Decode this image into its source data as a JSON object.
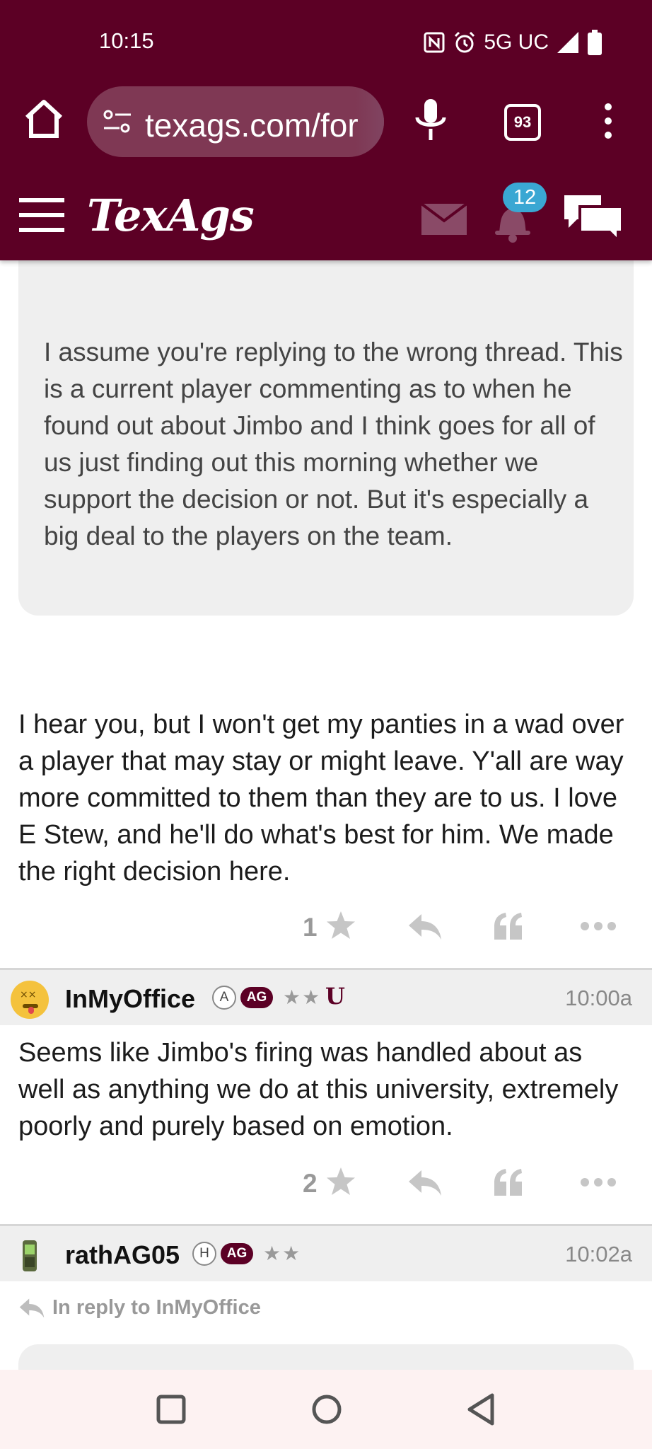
{
  "status_bar": {
    "time": "10:15",
    "network": "5G UC",
    "icons": [
      "nfc-icon",
      "alarm-icon",
      "signal-icon",
      "battery-icon"
    ]
  },
  "browser": {
    "url": "texags.com/for",
    "tab_count": "93",
    "icons": [
      "home-icon",
      "site-settings-icon",
      "mic-icon",
      "tabs-icon",
      "more-vert-icon"
    ]
  },
  "site_header": {
    "logo": "TexAgs",
    "notification_count": "12",
    "icons": [
      "hamburger-icon",
      "mail-icon",
      "bell-icon",
      "chat-icon"
    ]
  },
  "posts": [
    {
      "quote": "I assume you're replying to the wrong thread. This is a current player commenting as to when he found out about Jimbo and I think goes for all of us just finding out this morning whether we support the decision or not. But it's especially a big deal to the players on the team.",
      "body": "I hear you, but I won't get my panties in a wad over a player that may stay or might leave. Y'all are way more committed to them than they are to us. I love E Stew, and he'll do what's best for him. We made the right decision here.",
      "star_count": "1"
    },
    {
      "username": "InMyOffice",
      "badge_letter": "A",
      "badge_ag": "AG",
      "stars": "★★",
      "extra_badge": "U",
      "time": "10:00a",
      "body": "Seems like Jimbo's firing was handled about as well as anything we do at this university, extremely poorly and purely based on emotion.",
      "star_count": "2"
    },
    {
      "username": "rathAG05",
      "badge_letter": "H",
      "badge_ag": "AG",
      "stars": "★★",
      "time": "10:02a",
      "reply_to": "In reply to InMyOffice"
    }
  ],
  "colors": {
    "brand_maroon": "#5c0025",
    "badge_blue": "#3aa7d3",
    "quote_bg": "#efefef",
    "muted_gray": "#999999"
  }
}
